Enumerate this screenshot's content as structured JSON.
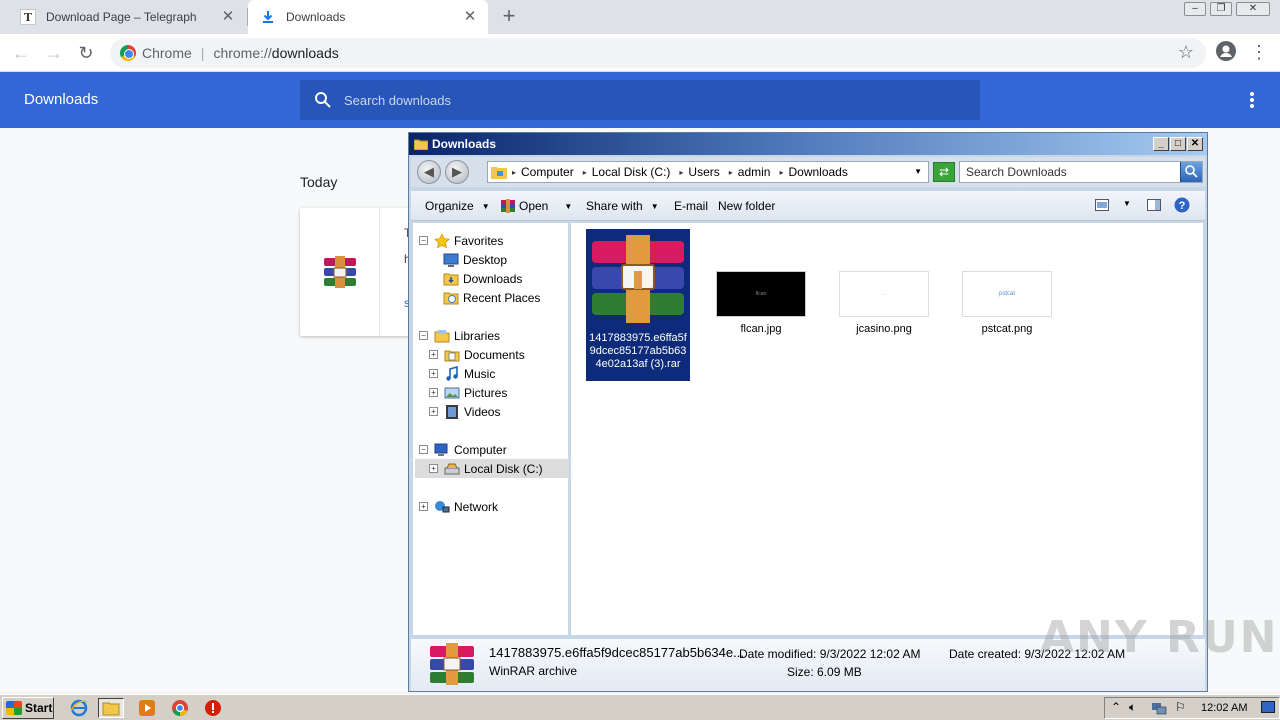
{
  "browser": {
    "tabs": [
      {
        "label": "Download Page – Telegraph",
        "favicon": "T"
      },
      {
        "label": "Downloads"
      }
    ],
    "omnibox": {
      "site": "Chrome",
      "url_scheme": "chrome://",
      "url_host": "downloads"
    }
  },
  "downloads_page": {
    "title": "Downloads",
    "search_placeholder": "Search downloads",
    "section_today": "Today",
    "card_text_1": "T",
    "card_text_2": "h",
    "card_text_3": "s"
  },
  "explorer": {
    "title": "Downloads",
    "breadcrumb": [
      "Computer",
      "Local Disk (C:)",
      "Users",
      "admin",
      "Downloads"
    ],
    "search_placeholder": "Search Downloads",
    "commands": {
      "organize": "Organize",
      "open": "Open",
      "share_with": "Share with",
      "email": "E-mail",
      "new_folder": "New folder"
    },
    "nav": {
      "favorites": "Favorites",
      "desktop": "Desktop",
      "downloads": "Downloads",
      "recent_places": "Recent Places",
      "libraries": "Libraries",
      "documents": "Documents",
      "music": "Music",
      "pictures": "Pictures",
      "videos": "Videos",
      "computer": "Computer",
      "local_disk": "Local Disk (C:)",
      "network": "Network"
    },
    "files": [
      {
        "name": "1417883975.e6ffa5f9dcec85177ab5b634e02a13af (3).rar",
        "selected": true
      },
      {
        "name": "flcan.jpg",
        "thumb_text": "flcan"
      },
      {
        "name": "jcasino.png",
        "thumb_text": "..."
      },
      {
        "name": "pstcat.png",
        "thumb_text": "pstcat"
      }
    ],
    "details": {
      "filename": "1417883975.e6ffa5f9dcec85177ab5b634e...",
      "type": "WinRAR archive",
      "date_modified": "Date modified: 9/3/2022 12:02 AM",
      "size": "Size: 6.09 MB",
      "date_created": "Date created: 9/3/2022 12:02 AM"
    }
  },
  "watermark": "ANY RUN",
  "taskbar": {
    "start": "Start",
    "clock": "12:02 AM"
  },
  "colors": {
    "chrome_header": "#3367d6",
    "selection": "#0d2b7a"
  }
}
